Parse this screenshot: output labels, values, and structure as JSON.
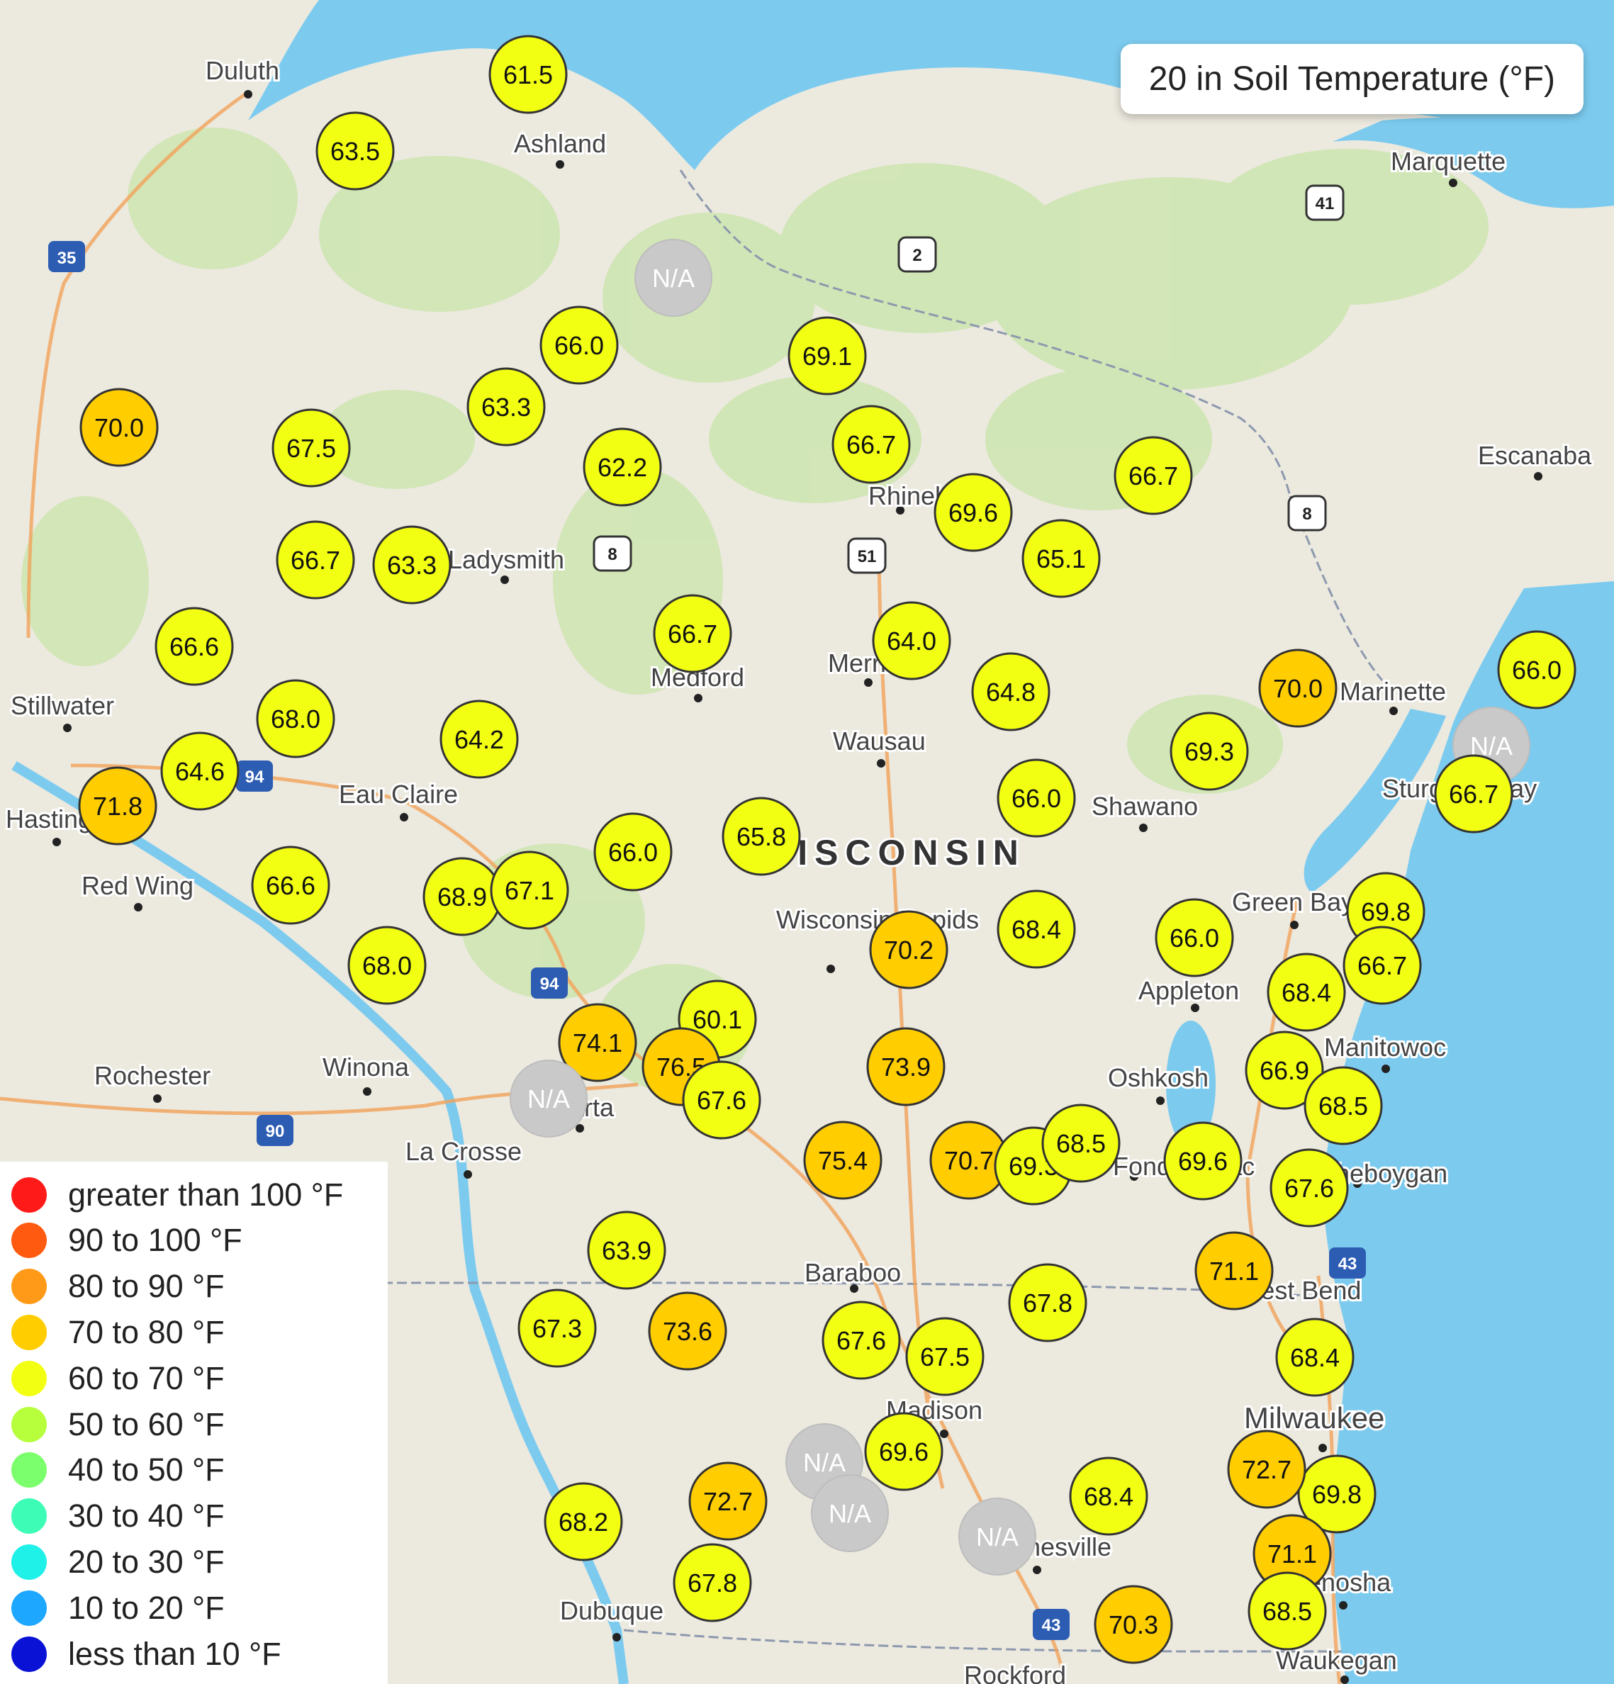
{
  "title": "20 in Soil Temperature (°F)",
  "colors": {
    "water": "#7ccbef",
    "land": "#ece9df",
    "forest": "#cfe6b2",
    "interstate_line": "#f2a35a",
    "border": "#8d99ae",
    "yellow_marker": "#f3ff12",
    "orange_marker": "#ffcd00",
    "na_marker": "#c9c9c9"
  },
  "legend": [
    {
      "label": "greater than 100 °F",
      "color": "#ff1a1a"
    },
    {
      "label": "90 to 100 °F",
      "color": "#ff5a0f"
    },
    {
      "label": "80 to 90 °F",
      "color": "#ff9a18"
    },
    {
      "label": "70 to 80 °F",
      "color": "#ffcd00"
    },
    {
      "label": "60 to 70 °F",
      "color": "#f3ff12"
    },
    {
      "label": "50 to 60 °F",
      "color": "#b7ff3d"
    },
    {
      "label": "40 to 50 °F",
      "color": "#7cff6c"
    },
    {
      "label": "30 to 40 °F",
      "color": "#3dfcb6"
    },
    {
      "label": "20 to 30 °F",
      "color": "#1ff0e8"
    },
    {
      "label": "10 to 20 °F",
      "color": "#1ea7ff"
    },
    {
      "label": "less than 10 °F",
      "color": "#0a12d6"
    }
  ],
  "cities": [
    "Duluth",
    "Ashland",
    "Marquette",
    "Escanaba",
    "Ladysmith",
    "Medford",
    "Merrill",
    "Rhinelander",
    "Wausau",
    "Stillwater",
    "Hastings",
    "Eau Claire",
    "Red Wing",
    "Shawano",
    "Marinette",
    "Green Bay",
    "Wisconsin Rapids",
    "Appleton",
    "Rochester",
    "Winona",
    "Sparta",
    "La Crosse",
    "Oshkosh",
    "Manitowoc",
    "Fond du Lac",
    "Sheboygan",
    "Baraboo",
    "West Bend",
    "Madison",
    "Milwaukee",
    "Dubuque",
    "Janesville",
    "Kenosha",
    "Waukegan",
    "Sturgeon Bay",
    "Rockford"
  ],
  "state_label": "WISCONSIN",
  "highway_shields": [
    "35",
    "2",
    "41",
    "8",
    "8",
    "51",
    "94",
    "94",
    "90",
    "43",
    "43"
  ],
  "readings": [
    "61.5",
    "63.5",
    "N/A",
    "66.0",
    "69.1",
    "63.3",
    "70.0",
    "67.5",
    "66.7",
    "62.2",
    "66.7",
    "69.6",
    "65.1",
    "66.7",
    "63.3",
    "66.6",
    "66.7",
    "64.0",
    "64.8",
    "70.0",
    "66.0",
    "68.0",
    "64.2",
    "69.3",
    "N/A",
    "64.6",
    "71.8",
    "66.0",
    "65.8",
    "66.7",
    "66.6",
    "68.9",
    "67.1",
    "66.0",
    "69.8",
    "68.4",
    "70.2",
    "68.4",
    "66.0",
    "66.7",
    "68.0",
    "60.1",
    "74.1",
    "76.5",
    "73.9",
    "66.9",
    "68.5",
    "N/A",
    "67.6",
    "75.4",
    "70.7",
    "69.3",
    "68.5",
    "69.6",
    "67.6",
    "63.9",
    "71.1",
    "67.3",
    "73.6",
    "67.8",
    "67.6",
    "67.5",
    "68.4",
    "N/A",
    "69.6",
    "N/A",
    "72.7",
    "69.8",
    "68.2",
    "N/A",
    "72.7",
    "68.4",
    "71.1",
    "67.8",
    "70.3",
    "68.5"
  ]
}
